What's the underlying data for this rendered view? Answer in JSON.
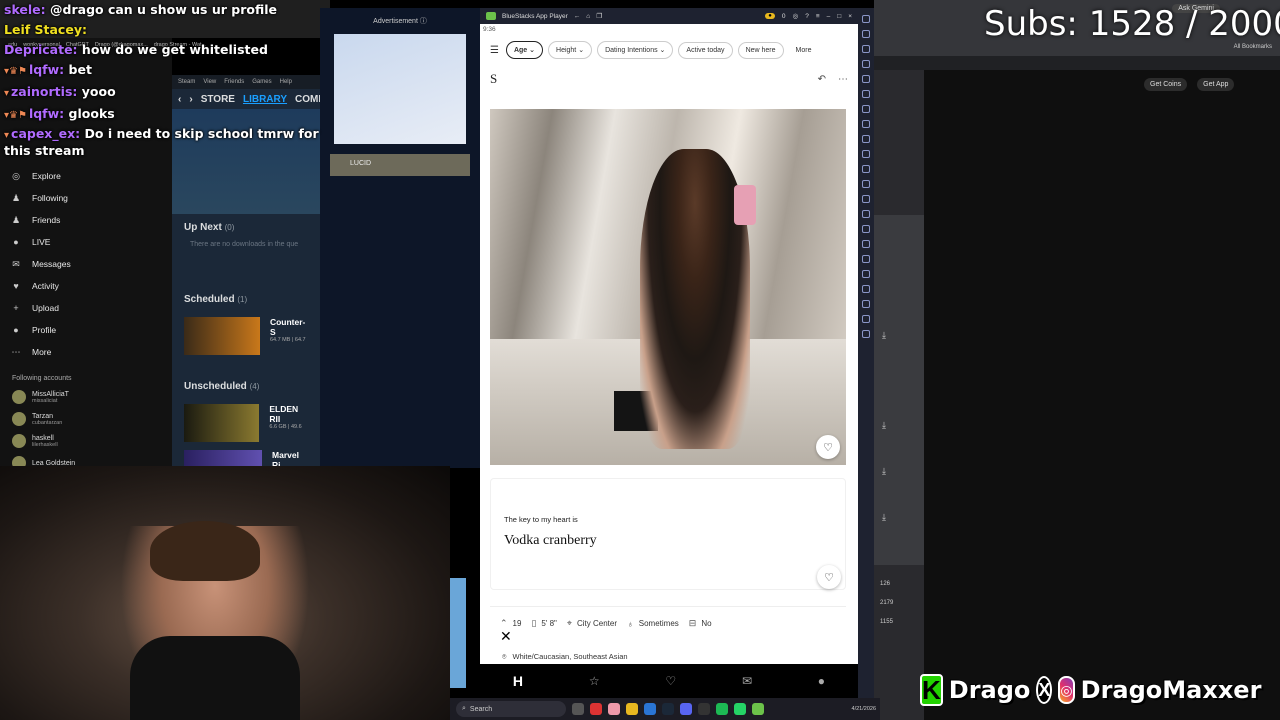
{
  "chat": {
    "lines": [
      {
        "user": "skele:",
        "text": "@drago can u show us ur profile",
        "badges": "",
        "color": "purple"
      },
      {
        "user": "Leif Stacey:",
        "text": "",
        "badges": "",
        "color": "yellow"
      },
      {
        "user": "Depricate:",
        "text": "how do we get whitelisted",
        "badges": "",
        "color": "purple"
      },
      {
        "user": "lqfw:",
        "text": "bet",
        "badges": "▾♛⚑",
        "color": "purple"
      },
      {
        "user": "zainortis:",
        "text": "yooo",
        "badges": "▾",
        "color": "purple"
      },
      {
        "user": "lqfw:",
        "text": "glooks",
        "badges": "▾♛⚑",
        "color": "purple"
      },
      {
        "user": "capex_ex:",
        "text": "Do i need to skip school tmrw for this stream",
        "badges": "▾",
        "color": "purple"
      }
    ]
  },
  "tiktok": {
    "url": "tiktok.com",
    "nav": [
      {
        "label": "Explore",
        "icon": "compass-icon",
        "glyph": "◎"
      },
      {
        "label": "Following",
        "icon": "following-icon",
        "glyph": "♟"
      },
      {
        "label": "Friends",
        "icon": "friends-icon",
        "glyph": "♟"
      },
      {
        "label": "LIVE",
        "icon": "live-icon",
        "glyph": "●"
      },
      {
        "label": "Messages",
        "icon": "messages-icon",
        "glyph": "✉"
      },
      {
        "label": "Activity",
        "icon": "activity-icon",
        "glyph": "♥"
      },
      {
        "label": "Upload",
        "icon": "upload-icon",
        "glyph": "+"
      },
      {
        "label": "Profile",
        "icon": "profile-icon",
        "glyph": "●"
      },
      {
        "label": "More",
        "icon": "more-icon",
        "glyph": "⋯"
      }
    ],
    "following_title": "Following accounts",
    "accounts": [
      {
        "name": "MissAlliciaT",
        "handle": "missaliciat"
      },
      {
        "name": "Tarzan",
        "handle": "cubantarzan"
      },
      {
        "name": "haskell",
        "handle": "lilerhaskell"
      },
      {
        "name": "Lea Goldstein",
        "handle": ""
      }
    ],
    "bookmarks": [
      "edu",
      "wonkypersonal",
      "ChatGPT",
      "Drago (@dragomax...",
      "drago Stream - Wat..."
    ]
  },
  "steam": {
    "menu": [
      "Steam",
      "View",
      "Friends",
      "Games",
      "Help"
    ],
    "nav": {
      "store": "STORE",
      "library": "LIBRARY",
      "community": "COMM"
    },
    "up_next": {
      "title": "Up Next",
      "count": "(0)",
      "empty": "There are no downloads in the que"
    },
    "scheduled": {
      "title": "Scheduled",
      "count": "(1)",
      "game": "Counter-S",
      "size": "64.7 MB | 64.7"
    },
    "unscheduled": {
      "title": "Unscheduled",
      "count": "(4)",
      "game": "ELDEN RII",
      "size": "6.6 GB | 49.6"
    },
    "next_game": "Marvel Ri"
  },
  "ad": {
    "label": "Advertisement ⓘ",
    "strip_text": "LUCID"
  },
  "bluestacks": {
    "title": "BlueStacks App Player",
    "coins": "0",
    "status_time": "9:36",
    "filters": [
      "Age",
      "Height",
      "Dating Intentions",
      "Active today",
      "New here",
      "More"
    ],
    "profile_name": "S",
    "prompt_question": "The key to my heart is",
    "prompt_answer": "Vodka cranberry",
    "vitals": [
      {
        "icon": "age-icon",
        "glyph": "⌃",
        "label": "19"
      },
      {
        "icon": "height-icon",
        "glyph": "▯",
        "label": "5' 8\""
      },
      {
        "icon": "location-icon",
        "glyph": "⌖",
        "label": "City Center"
      },
      {
        "icon": "drink-icon",
        "glyph": "♁",
        "label": "Sometimes"
      },
      {
        "icon": "smoke-icon",
        "glyph": "⊟",
        "label": "No"
      }
    ],
    "ethnicity": "White/Caucasian, Southeast Asian"
  },
  "right_browser": {
    "gemini": "Ask Gemini",
    "bookmarks": "All Bookmarks",
    "get_coins": "Get Coins",
    "get_app": "Get App",
    "counts": [
      "126",
      "2179",
      "1155"
    ]
  },
  "overlay": {
    "subs": "Subs: 1528 / 2000",
    "kick_name": "Drago",
    "instagram_name": "DragoMaxxer"
  },
  "taskbar": {
    "search": "Search",
    "date": "4/21/2026"
  }
}
